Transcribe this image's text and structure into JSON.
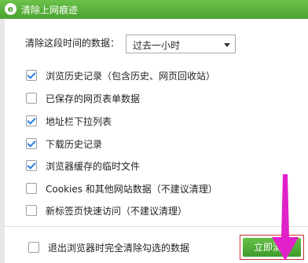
{
  "window": {
    "title": "清除上网痕迹"
  },
  "range": {
    "label": "清除这段时间的数据：",
    "selected": "过去一小时"
  },
  "options": [
    {
      "label": "浏览历史记录（包含历史、网页回收站）",
      "checked": true
    },
    {
      "label": "已保存的网页表单数据",
      "checked": false
    },
    {
      "label": "地址栏下拉列表",
      "checked": true
    },
    {
      "label": "下载历史记录",
      "checked": true
    },
    {
      "label": "浏览器缓存的临时文件",
      "checked": true
    },
    {
      "label": "Cookies 和其他网站数据（不建议清理）",
      "checked": false
    },
    {
      "label": "新标签页快速访问（不建议清理）",
      "checked": false
    }
  ],
  "footer": {
    "exit_clear_label": "退出浏览器时完全清除勾选的数据",
    "exit_clear_checked": false
  },
  "actions": {
    "clear_now_label": "立即清"
  },
  "colors": {
    "title_bar": "#4aa22f",
    "button": "#4aa22f",
    "checkmark": "#2b7de0",
    "annotation_arrow": "#e020c8"
  }
}
